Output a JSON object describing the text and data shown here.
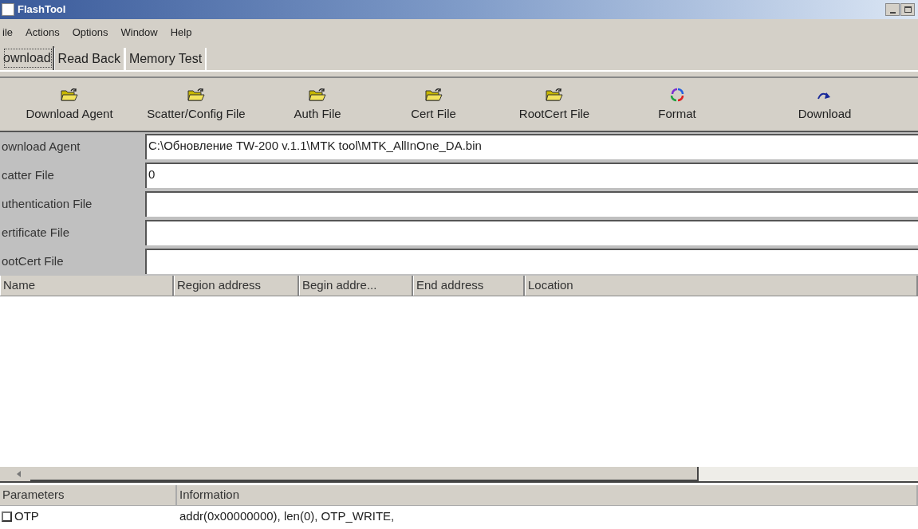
{
  "window": {
    "title": "FlashTool"
  },
  "menu": [
    "ile",
    "Actions",
    "Options",
    "Window",
    "Help"
  ],
  "tabs": [
    {
      "label": "ownload",
      "selected": true
    },
    {
      "label": "Read Back",
      "selected": false
    },
    {
      "label": "Memory Test",
      "selected": false
    }
  ],
  "toolbar": [
    {
      "label": "Download Agent",
      "kind": "folder"
    },
    {
      "label": "Scatter/Config File",
      "kind": "folder"
    },
    {
      "label": "Auth File",
      "kind": "folder"
    },
    {
      "label": "Cert File",
      "kind": "folder"
    },
    {
      "label": "RootCert File",
      "kind": "folder"
    },
    {
      "label": "Format",
      "kind": "format"
    },
    {
      "label": "Download",
      "kind": "download"
    }
  ],
  "fields": [
    {
      "label": "ownload Agent",
      "value": "C:\\Обновление TW-200 v.1.1\\MTK tool\\MTK_AllInOne_DA.bin"
    },
    {
      "label": "catter File",
      "value": "0"
    },
    {
      "label": "uthentication File"
    },
    {
      "label": "ertificate File"
    },
    {
      "label": "ootCert File"
    }
  ],
  "region_table": {
    "columns": [
      "Name",
      "Region address",
      "Begin addre...",
      "End address",
      "Location"
    ]
  },
  "parameters_table": {
    "columns": [
      "Parameters",
      "Information"
    ],
    "rows": [
      {
        "parameter": "OTP",
        "checked": false,
        "information": "addr(0x00000000), len(0), OTP_WRITE,"
      }
    ]
  }
}
